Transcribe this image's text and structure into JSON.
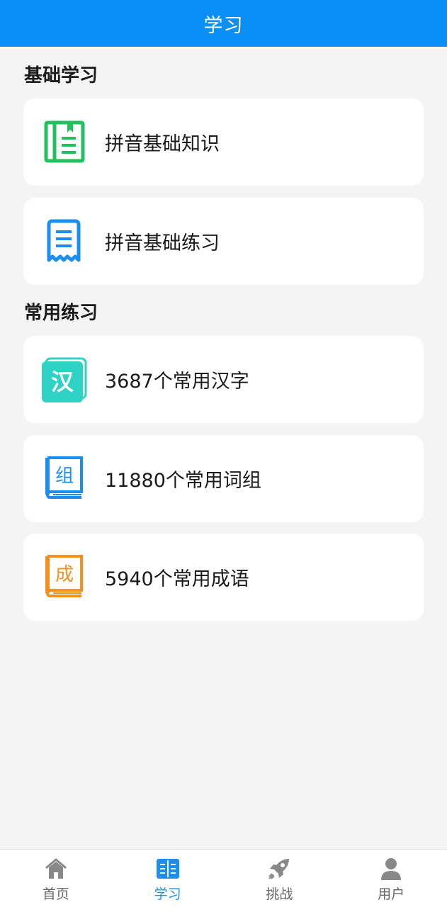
{
  "header": {
    "title": "学习"
  },
  "sections": [
    {
      "title": "基础学习",
      "items": [
        {
          "label": "拼音基础知识",
          "icon": "document-list-icon",
          "color": "#22c15e"
        },
        {
          "label": "拼音基础练习",
          "icon": "receipt-icon",
          "color": "#1b8ef0"
        }
      ]
    },
    {
      "title": "常用练习",
      "items": [
        {
          "label": "3687个常用汉字",
          "icon": "han-card-icon",
          "icon_text": "汉",
          "color": "#2ed3c6"
        },
        {
          "label": "11880个常用词组",
          "icon": "zu-book-icon",
          "icon_text": "组",
          "color": "#1b8ef0"
        },
        {
          "label": "5940个常用成语",
          "icon": "cheng-book-icon",
          "icon_text": "成",
          "color": "#f5901e"
        }
      ]
    }
  ],
  "tabbar": {
    "active_color": "#1b8ef0",
    "inactive_color": "#888888",
    "items": [
      {
        "label": "首页",
        "icon": "home-icon",
        "active": false
      },
      {
        "label": "学习",
        "icon": "book-icon",
        "active": true
      },
      {
        "label": "挑战",
        "icon": "rocket-icon",
        "active": false
      },
      {
        "label": "用户",
        "icon": "user-icon",
        "active": false
      }
    ]
  }
}
